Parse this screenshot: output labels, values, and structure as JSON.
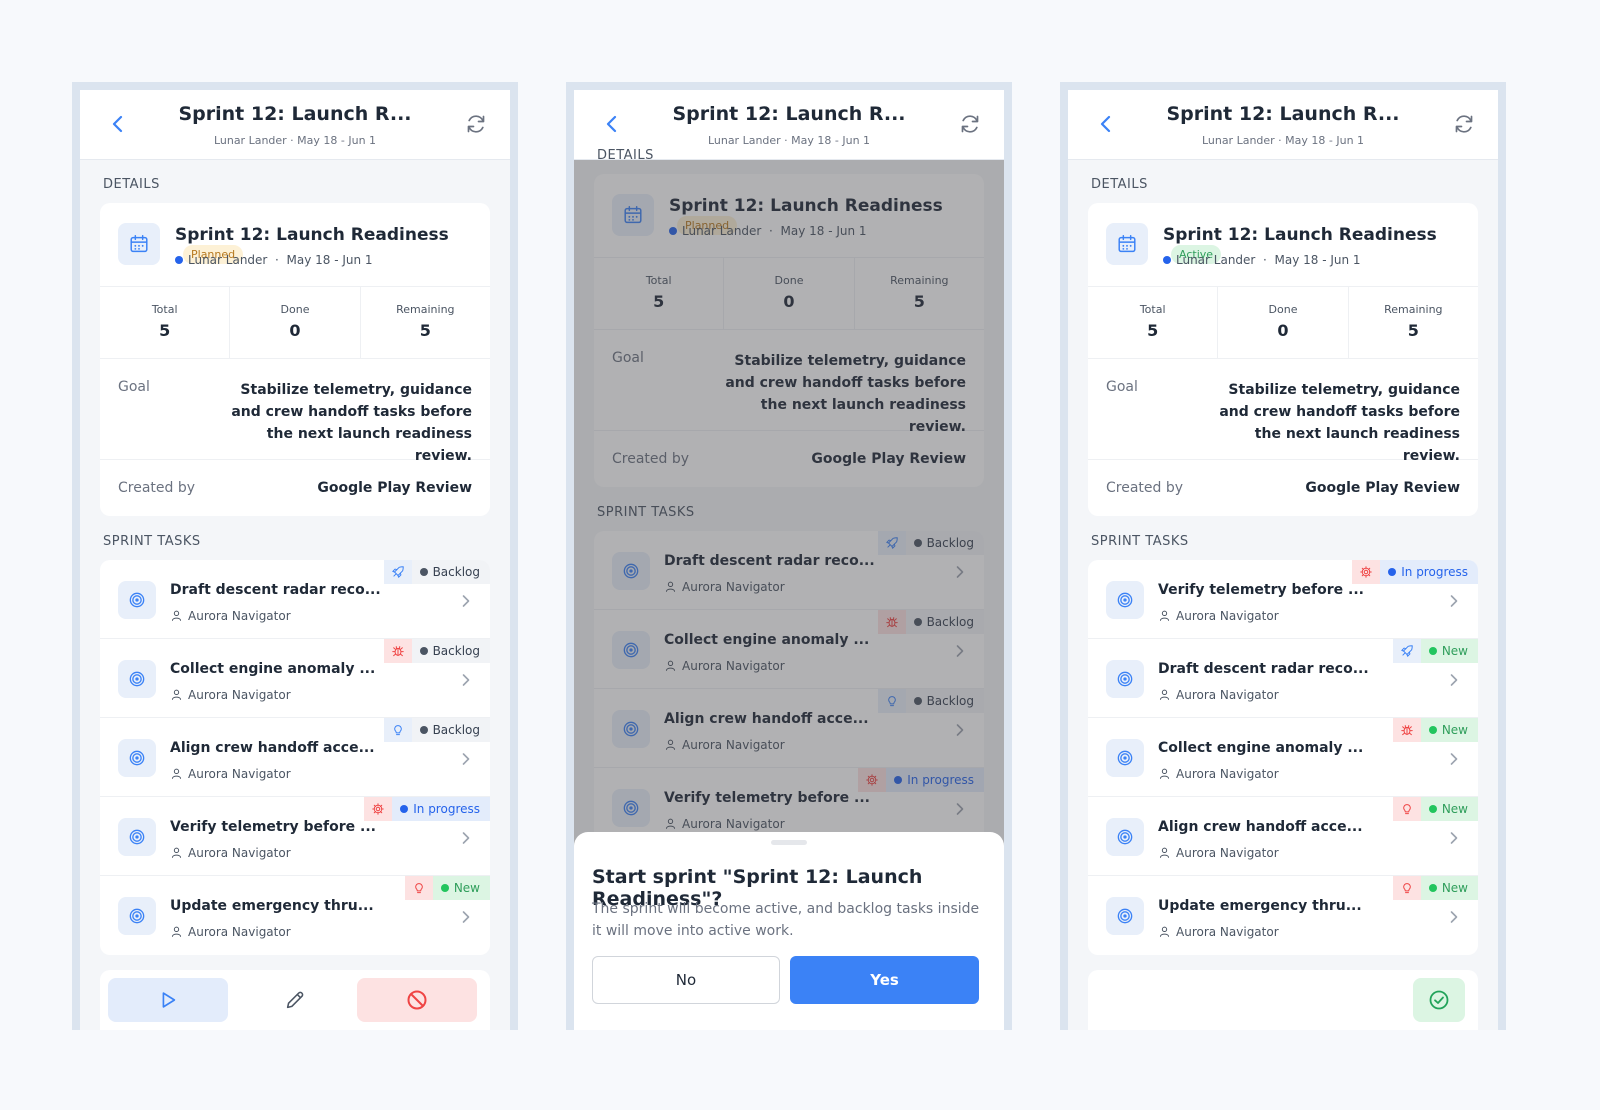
{
  "header": {
    "title": "Sprint 12: Launch R...",
    "subtitle": "Lunar Lander · May 18 - Jun 1"
  },
  "labels": {
    "details": "DETAILS",
    "sprint_tasks": "SPRINT TASKS",
    "total": "Total",
    "done": "Done",
    "remaining": "Remaining",
    "goal": "Goal",
    "created_by": "Created by"
  },
  "sprint": {
    "name": "Sprint 12: Launch Readiness",
    "project": "Lunar Lander",
    "dates": "May 18 - Jun 1",
    "status_planned": "Planned",
    "status_active": "Active",
    "total": "5",
    "done": "0",
    "remaining": "5",
    "goal": "Stabilize telemetry, guidance and crew handoff tasks before the next launch readiness review.",
    "created_by": "Google Play Review",
    "meta_sep": "·"
  },
  "tasks_planned": [
    {
      "title": "Draft descent radar reco...",
      "assignee": "Aurora Navigator",
      "type_icon": "rocket-icon",
      "status": "Backlog"
    },
    {
      "title": "Collect engine anomaly ...",
      "assignee": "Aurora Navigator",
      "type_icon": "bug-icon",
      "status": "Backlog"
    },
    {
      "title": "Align crew handoff acce...",
      "assignee": "Aurora Navigator",
      "type_icon": "lightbulb-icon",
      "status": "Backlog"
    },
    {
      "title": "Verify telemetry before ...",
      "assignee": "Aurora Navigator",
      "type_icon": "gear-icon",
      "status": "In progress"
    },
    {
      "title": "Update emergency thru...",
      "assignee": "Aurora Navigator",
      "type_icon": "lightbulb-icon",
      "status": "New"
    }
  ],
  "tasks_active": [
    {
      "title": "Verify telemetry before ...",
      "assignee": "Aurora Navigator",
      "type_icon": "gear-icon",
      "status": "In progress"
    },
    {
      "title": "Draft descent radar reco...",
      "assignee": "Aurora Navigator",
      "type_icon": "rocket-icon",
      "status": "New"
    },
    {
      "title": "Collect engine anomaly ...",
      "assignee": "Aurora Navigator",
      "type_icon": "bug-icon",
      "status": "New"
    },
    {
      "title": "Align crew handoff acce...",
      "assignee": "Aurora Navigator",
      "type_icon": "lightbulb-icon",
      "status": "New"
    },
    {
      "title": "Update emergency thru...",
      "assignee": "Aurora Navigator",
      "type_icon": "lightbulb-icon",
      "status": "New"
    }
  ],
  "dialog": {
    "title": "Start sprint \"Sprint 12: Launch Readiness\"?",
    "text": "The sprint will become active, and backlog tasks inside it will move into active work.",
    "no": "No",
    "yes": "Yes"
  },
  "colors": {
    "accent": "#3b82f6",
    "planned": "#b7791f",
    "active": "#2f9e5b",
    "in_progress": "#2563eb",
    "danger": "#ef4444"
  }
}
